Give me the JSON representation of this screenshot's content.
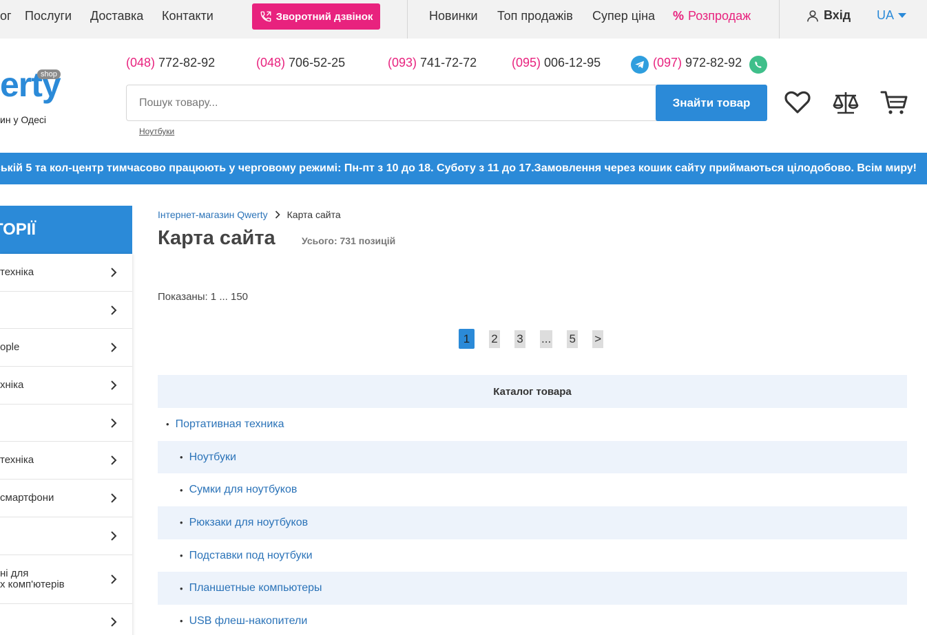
{
  "topbar": {
    "nav_left": [
      "ог",
      "Послуги",
      "Доставка",
      "Контакти"
    ],
    "callback_label": "Зворотний дзвінок",
    "nav_right": [
      "Новинки",
      "Топ продажів",
      "Супер ціна"
    ],
    "sale_icon": "%",
    "sale_label": "Розпродаж",
    "login_label": "Вхід",
    "lang_label": "UA"
  },
  "header": {
    "logo_text": "erty",
    "logo_badge": "shop",
    "logo_tagline": "ин у Одесі",
    "phones": [
      {
        "code": "(048)",
        "number": " 772-82-92"
      },
      {
        "code": "(048)",
        "number": " 706-52-25"
      },
      {
        "code": "(093)",
        "number": " 741-72-72"
      },
      {
        "code": "(095)",
        "number": " 006-12-95"
      },
      {
        "code": "(097)",
        "number": " 972-82-92"
      }
    ],
    "search_placeholder": "Пошук товару...",
    "search_button": "Знайти товар",
    "search_hint": "Ноутбуки"
  },
  "notice": "мійській 5 та кол-центр тимчасово працюють у черговому режимі: Пн-пт з 10 до 18. Суботу з 11 до 17.Замовлення через кошик сайту приймаються цілодобово. Всім миру!",
  "sidebar": {
    "title": "ТОРІЇ",
    "items": [
      "техніка",
      "",
      "ople",
      "хніка",
      "",
      "техніка",
      "смартфони",
      "",
      "ні для\nх комп'ютерів",
      ""
    ]
  },
  "main": {
    "breadcrumb_home": "Інтернет-магазин Qwerty",
    "breadcrumb_current": "Карта сайта",
    "title": "Карта сайта",
    "total": "Усього: 731 позицій",
    "shown": "Показаны: 1 ... 150",
    "pages": [
      "1",
      "2",
      "3",
      "...",
      "5",
      ">"
    ],
    "catalog_heading": "Каталог товара",
    "catalog": [
      {
        "label": "Портативная техника",
        "level": 1
      },
      {
        "label": "Ноутбуки",
        "level": 2
      },
      {
        "label": "Сумки для ноутбуков",
        "level": 2
      },
      {
        "label": "Рюкзаки для ноутбуков",
        "level": 2
      },
      {
        "label": "Подставки под ноутбуки",
        "level": 2
      },
      {
        "label": "Планшетные компьютеры",
        "level": 2
      },
      {
        "label": "USB флеш-накопители",
        "level": 2
      }
    ]
  },
  "colors": {
    "accent": "#2b8ad8",
    "pink": "#e8227e",
    "row_alt": "#edf3fb"
  }
}
